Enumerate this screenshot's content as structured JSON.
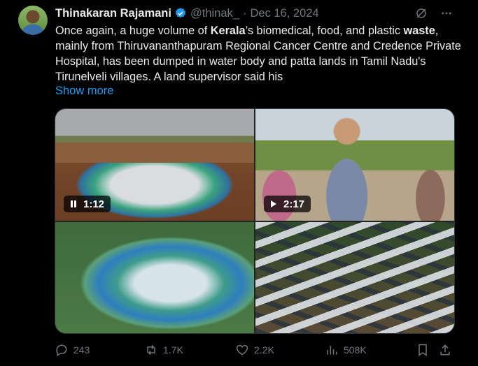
{
  "post": {
    "author_name": "Thinakaran Rajamani",
    "handle": "@thinak_",
    "separator": "·",
    "date": "Dec 16, 2024",
    "text_parts": {
      "p1": "Once again, a huge volume of ",
      "b1": "Kerala",
      "p2": "’s biomedical, food, and plastic ",
      "b2": "waste",
      "p3": ", mainly from Thiruvananthapuram Regional Cancer Centre and Credence Private Hospital, has been dumped in water body and patta lands in Tamil Nadu's Tirunelveli villages. A land supervisor said his"
    },
    "show_more": "Show more"
  },
  "media": {
    "video1_duration": "1:12",
    "video2_duration": "2:17"
  },
  "actions": {
    "replies": "243",
    "reposts": "1.7K",
    "likes": "2.2K",
    "views": "508K"
  },
  "colors": {
    "background": "#000000",
    "text": "#e7e9ea",
    "muted": "#71767b",
    "link": "#1d9bf0",
    "verified": "#1d9bf0"
  },
  "icons": [
    "grok-icon",
    "more-icon",
    "verified-badge-icon",
    "pause-icon",
    "play-icon",
    "reply-icon",
    "repost-icon",
    "like-icon",
    "views-icon",
    "bookmark-icon",
    "share-icon"
  ]
}
